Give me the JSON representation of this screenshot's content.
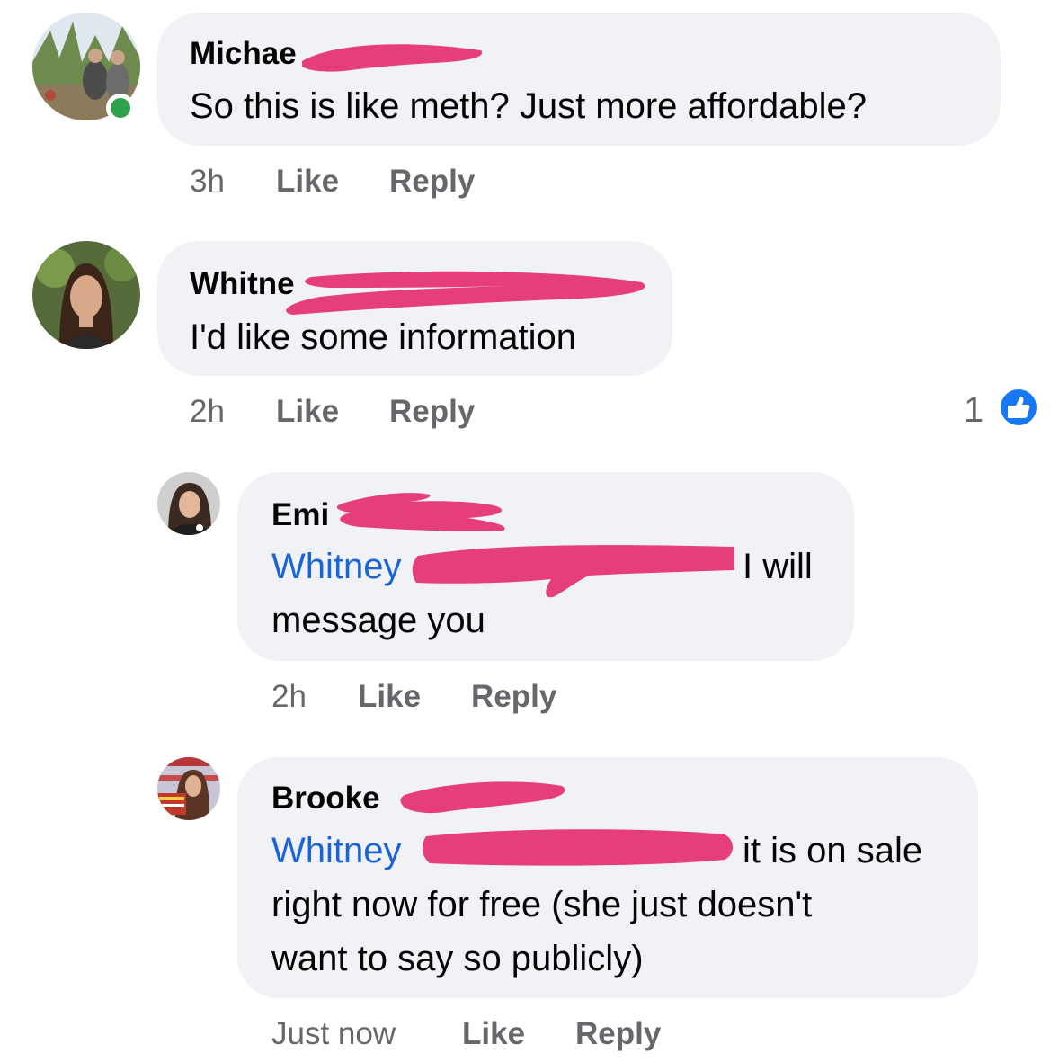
{
  "comments": [
    {
      "author": "Michae",
      "text": "So this is like meth? Just more affordable?",
      "time": "3h",
      "like": "Like",
      "reply": "Reply",
      "online": true
    },
    {
      "author": "Whitne",
      "text": "I'd like some information",
      "time": "2h",
      "like": "Like",
      "reply": "Reply",
      "reaction_count": "1",
      "reaction_icon": "thumbs-up-icon"
    },
    {
      "author": "Emi",
      "mention": "Whitney",
      "text_line1_rest": "I will",
      "text_line2": "message you",
      "time": "2h",
      "like": "Like",
      "reply": "Reply"
    },
    {
      "author": "Brooke",
      "mention": "Whitney",
      "text_line1_rest": "it is on sale",
      "text_line2": "right now for free (she just doesn't",
      "text_line3": "want to say so publicly)",
      "time": "Just now",
      "like": "Like",
      "reply": "Reply"
    }
  ],
  "colors": {
    "bubble": "#f0f2f5",
    "mention": "#1a65d6",
    "meta": "#65676b",
    "redaction": "#e63e7a",
    "online": "#31a24c",
    "like_badge": "#1877f2"
  }
}
